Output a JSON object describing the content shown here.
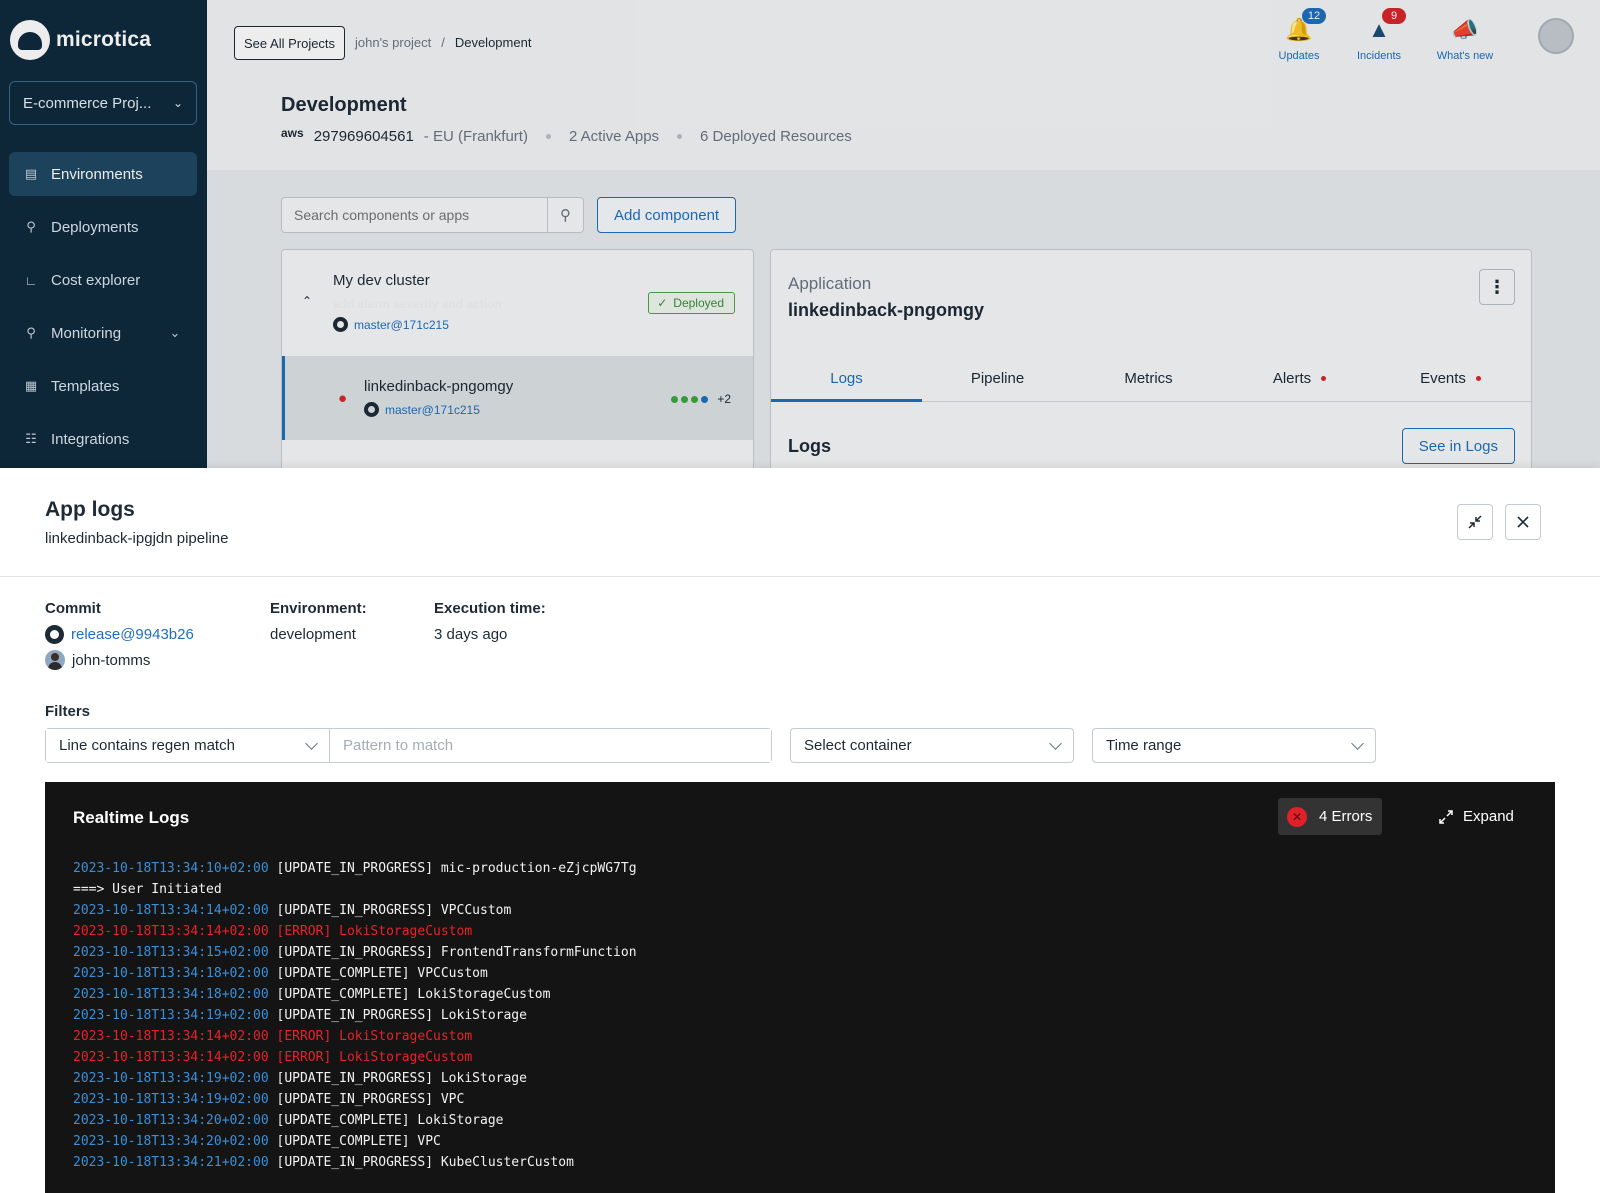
{
  "brand": {
    "name": "microtica"
  },
  "sidebar": {
    "project": "E-commerce Proj...",
    "items": [
      {
        "label": "Environments",
        "icon": "environments-icon",
        "active": true
      },
      {
        "label": "Deployments",
        "icon": "deployments-icon"
      },
      {
        "label": "Cost explorer",
        "icon": "chart-icon"
      },
      {
        "label": "Monitoring",
        "icon": "monitoring-icon",
        "has_submenu": true
      },
      {
        "label": "Templates",
        "icon": "grid-icon"
      },
      {
        "label": "Integrations",
        "icon": "integrations-icon"
      }
    ]
  },
  "topbar": {
    "see_all_projects": "See All Projects",
    "breadcrumb": {
      "project": "john's project",
      "separator": "/",
      "current": "Development"
    },
    "updates": {
      "label": "Updates",
      "count": "12"
    },
    "incidents": {
      "label": "Incidents",
      "count": "9"
    },
    "whats_new": {
      "label": "What's new"
    }
  },
  "environment": {
    "title": "Development",
    "provider": "aws",
    "account": "297969604561",
    "region": "- EU (Frankfurt)",
    "active_apps": "2 Active Apps",
    "deployed_resources": "6 Deployed Resources"
  },
  "toolbar": {
    "search_placeholder": "Search components or apps",
    "add_component": "Add component"
  },
  "components": {
    "cluster": {
      "name": "My dev cluster",
      "commit_message": "add alarm severity and action",
      "branch": "master@171c215",
      "status": "Deployed"
    },
    "app": {
      "name": "linkedinback-pngomgy",
      "branch": "master@171c215",
      "extra_pods": "+2"
    }
  },
  "application": {
    "label": "Application",
    "name": "linkedinback-pngomgy",
    "tabs": [
      {
        "label": "Logs",
        "active": true
      },
      {
        "label": "Pipeline"
      },
      {
        "label": "Metrics"
      },
      {
        "label": "Alerts",
        "alert": true
      },
      {
        "label": "Events",
        "alert": true
      }
    ],
    "logs_heading": "Logs",
    "see_in_logs": "See in Logs"
  },
  "drawer": {
    "title": "App logs",
    "subtitle": "linkedinback-ipgjdn pipeline",
    "commit": {
      "label": "Commit",
      "ref": "release@9943b26",
      "author": "john-tomms"
    },
    "environment": {
      "label": "Environment:",
      "value": "development"
    },
    "execution": {
      "label": "Execution time:",
      "value": "3 days ago"
    },
    "filters": {
      "label": "Filters",
      "match_type": "Line contains regen match",
      "pattern_placeholder": "Pattern to match",
      "container": "Select container",
      "time_range": "Time range"
    },
    "realtime": {
      "title": "Realtime Logs",
      "errors": "4 Errors",
      "expand": "Expand",
      "lines": [
        {
          "ts": "2023-10-18T13:34:10+02:00",
          "msg": "[UPDATE_IN_PROGRESS] mic-production-eZjcpWG7Tg",
          "level": "info"
        },
        {
          "ts": "",
          "msg": "===> User Initiated",
          "level": "info"
        },
        {
          "ts": "2023-10-18T13:34:14+02:00",
          "msg": "[UPDATE_IN_PROGRESS] VPCCustom",
          "level": "info"
        },
        {
          "ts": "2023-10-18T13:34:14+02:00",
          "msg": "[ERROR] LokiStorageCustom",
          "level": "error"
        },
        {
          "ts": "2023-10-18T13:34:15+02:00",
          "msg": "[UPDATE_IN_PROGRESS] FrontendTransformFunction",
          "level": "info"
        },
        {
          "ts": "2023-10-18T13:34:18+02:00",
          "msg": "[UPDATE_COMPLETE] VPCCustom",
          "level": "info"
        },
        {
          "ts": "2023-10-18T13:34:18+02:00",
          "msg": "[UPDATE_COMPLETE] LokiStorageCustom",
          "level": "info"
        },
        {
          "ts": "2023-10-18T13:34:19+02:00",
          "msg": "[UPDATE_IN_PROGRESS] LokiStorage",
          "level": "info"
        },
        {
          "ts": "2023-10-18T13:34:14+02:00",
          "msg": "[ERROR] LokiStorageCustom",
          "level": "error"
        },
        {
          "ts": "2023-10-18T13:34:14+02:00",
          "msg": "[ERROR] LokiStorageCustom",
          "level": "error"
        },
        {
          "ts": "2023-10-18T13:34:19+02:00",
          "msg": "[UPDATE_IN_PROGRESS] LokiStorage",
          "level": "info"
        },
        {
          "ts": "2023-10-18T13:34:19+02:00",
          "msg": "[UPDATE_IN_PROGRESS] VPC",
          "level": "info"
        },
        {
          "ts": "2023-10-18T13:34:20+02:00",
          "msg": "[UPDATE_COMPLETE] LokiStorage",
          "level": "info"
        },
        {
          "ts": "2023-10-18T13:34:20+02:00",
          "msg": "[UPDATE_COMPLETE] VPC",
          "level": "info"
        },
        {
          "ts": "2023-10-18T13:34:21+02:00",
          "msg": "[UPDATE_IN_PROGRESS] KubeClusterCustom",
          "level": "info"
        }
      ]
    }
  }
}
